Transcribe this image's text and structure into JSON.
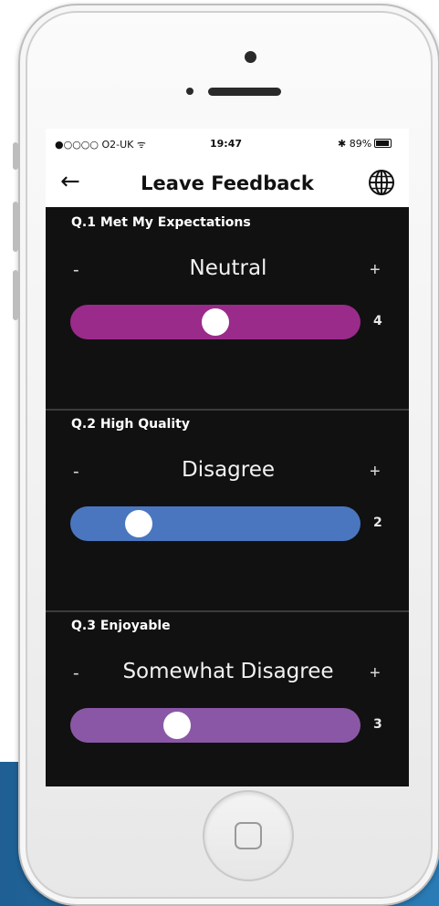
{
  "status_bar": {
    "carrier": "●○○○○ O2-UK ᯤ",
    "time": "19:47",
    "bluetooth_battery": "✱ 89%",
    "battery_level": 0.89
  },
  "nav": {
    "back_icon": "back-arrow-icon",
    "back_glyph": "←",
    "title": "Leave Feedback",
    "globe_icon": "globe-icon"
  },
  "questions": [
    {
      "label": "Q.1 Met My Expectations",
      "minus": "-",
      "plus": "+",
      "answer": "Neutral",
      "value": "4",
      "slider_fraction": 0.5,
      "color": "#9a2b8a"
    },
    {
      "label": "Q.2 High Quality",
      "minus": "-",
      "plus": "+",
      "answer": "Disagree",
      "value": "2",
      "slider_fraction": 0.2,
      "color": "#4a76bf"
    },
    {
      "label": "Q.3 Enjoyable",
      "minus": "-",
      "plus": "+",
      "answer": "Somewhat Disagree",
      "value": "3",
      "slider_fraction": 0.35,
      "color": "#8a57a6"
    }
  ],
  "device": {
    "home_button_icon": "home-button-icon"
  }
}
